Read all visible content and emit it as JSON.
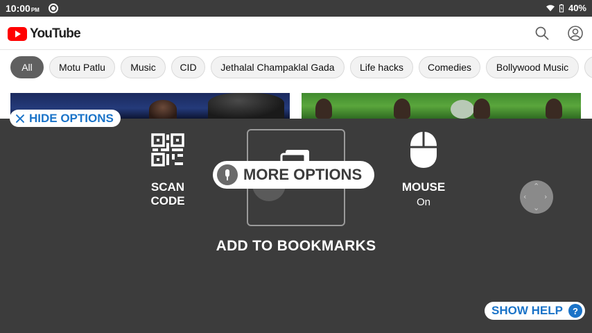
{
  "status_bar": {
    "time": "10:00",
    "ampm": "PM",
    "battery": "40%",
    "notification_icon": "focus-mode-icon",
    "icons": [
      "wifi-icon",
      "battery-charging-icon"
    ]
  },
  "header": {
    "logo_text": "YouTube",
    "search_icon": "search-icon",
    "account_icon": "account-circle-icon"
  },
  "chips": [
    {
      "label": "All",
      "active": true
    },
    {
      "label": "Motu Patlu",
      "active": false
    },
    {
      "label": "Music",
      "active": false
    },
    {
      "label": "CID",
      "active": false
    },
    {
      "label": "Jethalal Champaklal Gada",
      "active": false
    },
    {
      "label": "Life hacks",
      "active": false
    },
    {
      "label": "Comedies",
      "active": false
    },
    {
      "label": "Bollywood Music",
      "active": false
    }
  ],
  "overlay": {
    "hide_options": "HIDE OPTIONS",
    "scan_code": "SCAN CODE",
    "more_options": "MORE OPTIONS",
    "add_to_bookmarks": "ADD TO BOOKMARKS",
    "mouse": "MOUSE",
    "mouse_state": "On",
    "show_help": "SHOW HELP",
    "help_glyph": "?"
  },
  "colors": {
    "overlay_bg": "#3c3c3c",
    "accent_blue": "#1a73c8",
    "youtube_red": "#ff0000"
  }
}
